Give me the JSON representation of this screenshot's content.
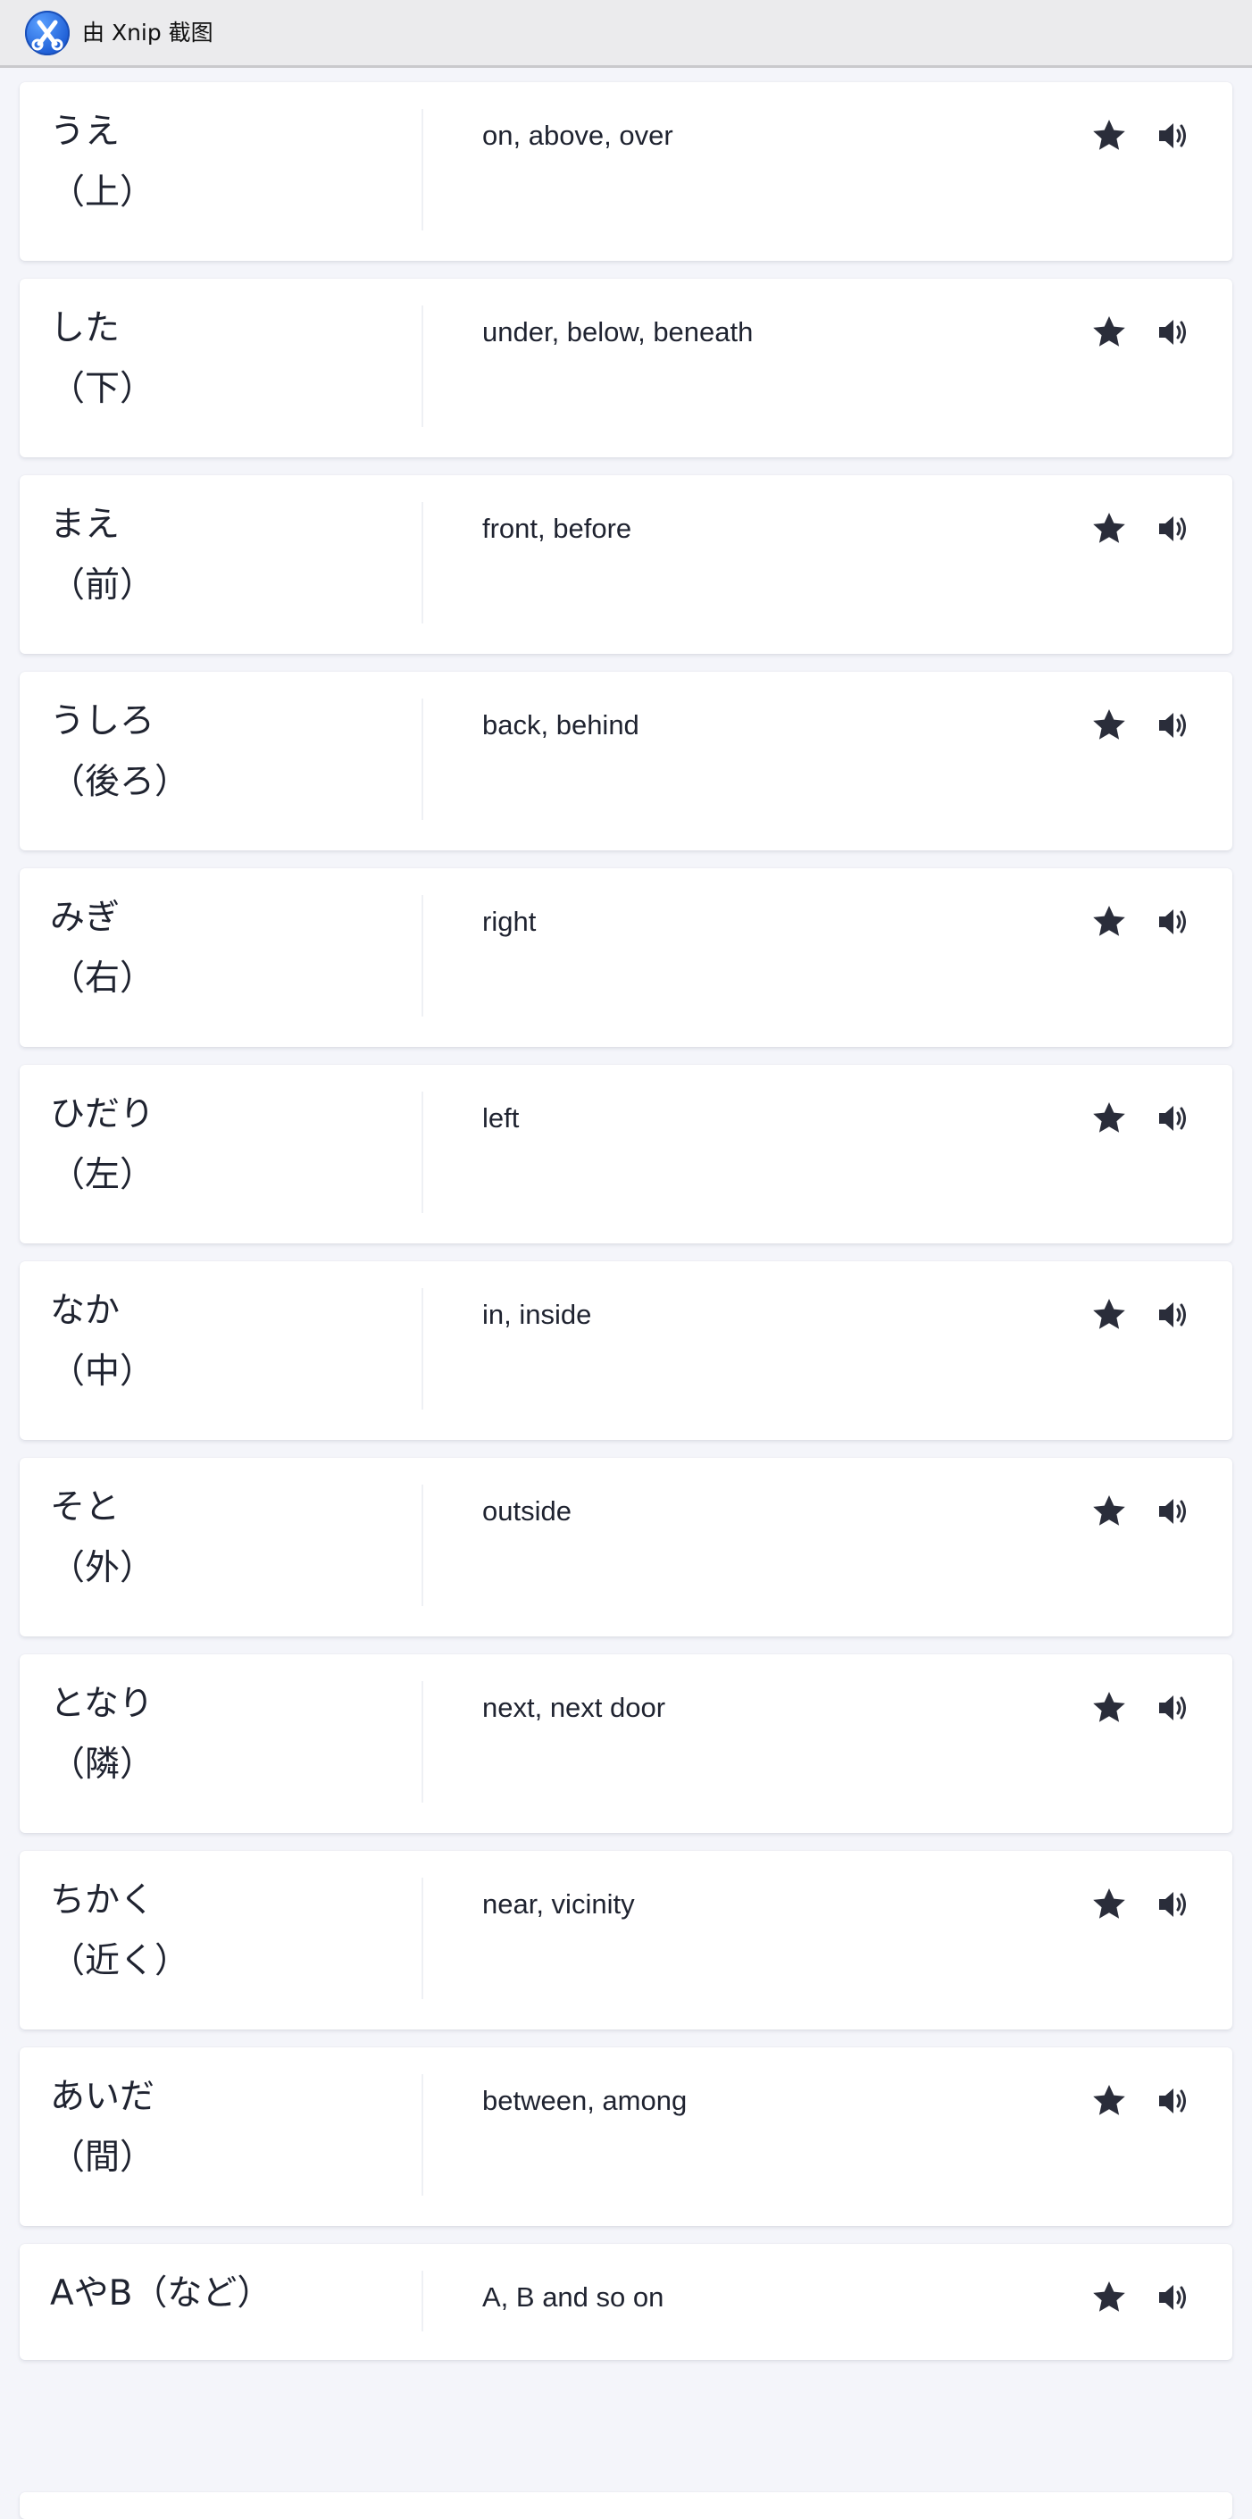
{
  "titlebar": {
    "text": "由 Xnip 截图"
  },
  "colors": {
    "background": "#f4f5fa",
    "card": "#ffffff",
    "text": "#1f2330",
    "icon": "#2a2d3a",
    "logo": "#2f6fe0"
  },
  "icons": {
    "favorite": "star-icon",
    "audio": "speaker-icon"
  },
  "cards": [
    {
      "reading": "うえ",
      "kanji": "（上）",
      "meaning": "on, above, over"
    },
    {
      "reading": "した",
      "kanji": "（下）",
      "meaning": "under, below, beneath"
    },
    {
      "reading": "まえ",
      "kanji": "（前）",
      "meaning": "front, before"
    },
    {
      "reading": "うしろ",
      "kanji": "（後ろ）",
      "meaning": "back, behind"
    },
    {
      "reading": "みぎ",
      "kanji": "（右）",
      "meaning": "right"
    },
    {
      "reading": "ひだり",
      "kanji": "（左）",
      "meaning": "left"
    },
    {
      "reading": "なか",
      "kanji": "（中）",
      "meaning": "in, inside"
    },
    {
      "reading": "そと",
      "kanji": "（外）",
      "meaning": "outside"
    },
    {
      "reading": "となり",
      "kanji": "（隣）",
      "meaning": "next, next door"
    },
    {
      "reading": "ちかく",
      "kanji": "（近く）",
      "meaning": "near, vicinity"
    },
    {
      "reading": "あいだ",
      "kanji": "（間）",
      "meaning": "between, among"
    },
    {
      "reading": "AやB（など）",
      "meaning": "A, B and so on"
    }
  ]
}
